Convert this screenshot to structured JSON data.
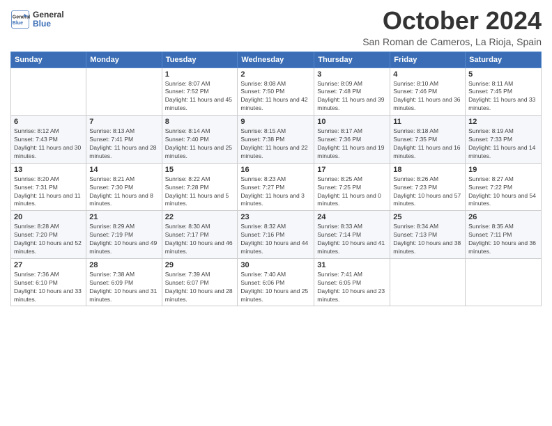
{
  "header": {
    "logo_line1": "General",
    "logo_line2": "Blue",
    "month_title": "October 2024",
    "subtitle": "San Roman de Cameros, La Rioja, Spain"
  },
  "weekdays": [
    "Sunday",
    "Monday",
    "Tuesday",
    "Wednesday",
    "Thursday",
    "Friday",
    "Saturday"
  ],
  "weeks": [
    [
      {
        "day": "",
        "info": ""
      },
      {
        "day": "",
        "info": ""
      },
      {
        "day": "1",
        "info": "Sunrise: 8:07 AM\nSunset: 7:52 PM\nDaylight: 11 hours and 45 minutes."
      },
      {
        "day": "2",
        "info": "Sunrise: 8:08 AM\nSunset: 7:50 PM\nDaylight: 11 hours and 42 minutes."
      },
      {
        "day": "3",
        "info": "Sunrise: 8:09 AM\nSunset: 7:48 PM\nDaylight: 11 hours and 39 minutes."
      },
      {
        "day": "4",
        "info": "Sunrise: 8:10 AM\nSunset: 7:46 PM\nDaylight: 11 hours and 36 minutes."
      },
      {
        "day": "5",
        "info": "Sunrise: 8:11 AM\nSunset: 7:45 PM\nDaylight: 11 hours and 33 minutes."
      }
    ],
    [
      {
        "day": "6",
        "info": "Sunrise: 8:12 AM\nSunset: 7:43 PM\nDaylight: 11 hours and 30 minutes."
      },
      {
        "day": "7",
        "info": "Sunrise: 8:13 AM\nSunset: 7:41 PM\nDaylight: 11 hours and 28 minutes."
      },
      {
        "day": "8",
        "info": "Sunrise: 8:14 AM\nSunset: 7:40 PM\nDaylight: 11 hours and 25 minutes."
      },
      {
        "day": "9",
        "info": "Sunrise: 8:15 AM\nSunset: 7:38 PM\nDaylight: 11 hours and 22 minutes."
      },
      {
        "day": "10",
        "info": "Sunrise: 8:17 AM\nSunset: 7:36 PM\nDaylight: 11 hours and 19 minutes."
      },
      {
        "day": "11",
        "info": "Sunrise: 8:18 AM\nSunset: 7:35 PM\nDaylight: 11 hours and 16 minutes."
      },
      {
        "day": "12",
        "info": "Sunrise: 8:19 AM\nSunset: 7:33 PM\nDaylight: 11 hours and 14 minutes."
      }
    ],
    [
      {
        "day": "13",
        "info": "Sunrise: 8:20 AM\nSunset: 7:31 PM\nDaylight: 11 hours and 11 minutes."
      },
      {
        "day": "14",
        "info": "Sunrise: 8:21 AM\nSunset: 7:30 PM\nDaylight: 11 hours and 8 minutes."
      },
      {
        "day": "15",
        "info": "Sunrise: 8:22 AM\nSunset: 7:28 PM\nDaylight: 11 hours and 5 minutes."
      },
      {
        "day": "16",
        "info": "Sunrise: 8:23 AM\nSunset: 7:27 PM\nDaylight: 11 hours and 3 minutes."
      },
      {
        "day": "17",
        "info": "Sunrise: 8:25 AM\nSunset: 7:25 PM\nDaylight: 11 hours and 0 minutes."
      },
      {
        "day": "18",
        "info": "Sunrise: 8:26 AM\nSunset: 7:23 PM\nDaylight: 10 hours and 57 minutes."
      },
      {
        "day": "19",
        "info": "Sunrise: 8:27 AM\nSunset: 7:22 PM\nDaylight: 10 hours and 54 minutes."
      }
    ],
    [
      {
        "day": "20",
        "info": "Sunrise: 8:28 AM\nSunset: 7:20 PM\nDaylight: 10 hours and 52 minutes."
      },
      {
        "day": "21",
        "info": "Sunrise: 8:29 AM\nSunset: 7:19 PM\nDaylight: 10 hours and 49 minutes."
      },
      {
        "day": "22",
        "info": "Sunrise: 8:30 AM\nSunset: 7:17 PM\nDaylight: 10 hours and 46 minutes."
      },
      {
        "day": "23",
        "info": "Sunrise: 8:32 AM\nSunset: 7:16 PM\nDaylight: 10 hours and 44 minutes."
      },
      {
        "day": "24",
        "info": "Sunrise: 8:33 AM\nSunset: 7:14 PM\nDaylight: 10 hours and 41 minutes."
      },
      {
        "day": "25",
        "info": "Sunrise: 8:34 AM\nSunset: 7:13 PM\nDaylight: 10 hours and 38 minutes."
      },
      {
        "day": "26",
        "info": "Sunrise: 8:35 AM\nSunset: 7:11 PM\nDaylight: 10 hours and 36 minutes."
      }
    ],
    [
      {
        "day": "27",
        "info": "Sunrise: 7:36 AM\nSunset: 6:10 PM\nDaylight: 10 hours and 33 minutes."
      },
      {
        "day": "28",
        "info": "Sunrise: 7:38 AM\nSunset: 6:09 PM\nDaylight: 10 hours and 31 minutes."
      },
      {
        "day": "29",
        "info": "Sunrise: 7:39 AM\nSunset: 6:07 PM\nDaylight: 10 hours and 28 minutes."
      },
      {
        "day": "30",
        "info": "Sunrise: 7:40 AM\nSunset: 6:06 PM\nDaylight: 10 hours and 25 minutes."
      },
      {
        "day": "31",
        "info": "Sunrise: 7:41 AM\nSunset: 6:05 PM\nDaylight: 10 hours and 23 minutes."
      },
      {
        "day": "",
        "info": ""
      },
      {
        "day": "",
        "info": ""
      }
    ]
  ]
}
